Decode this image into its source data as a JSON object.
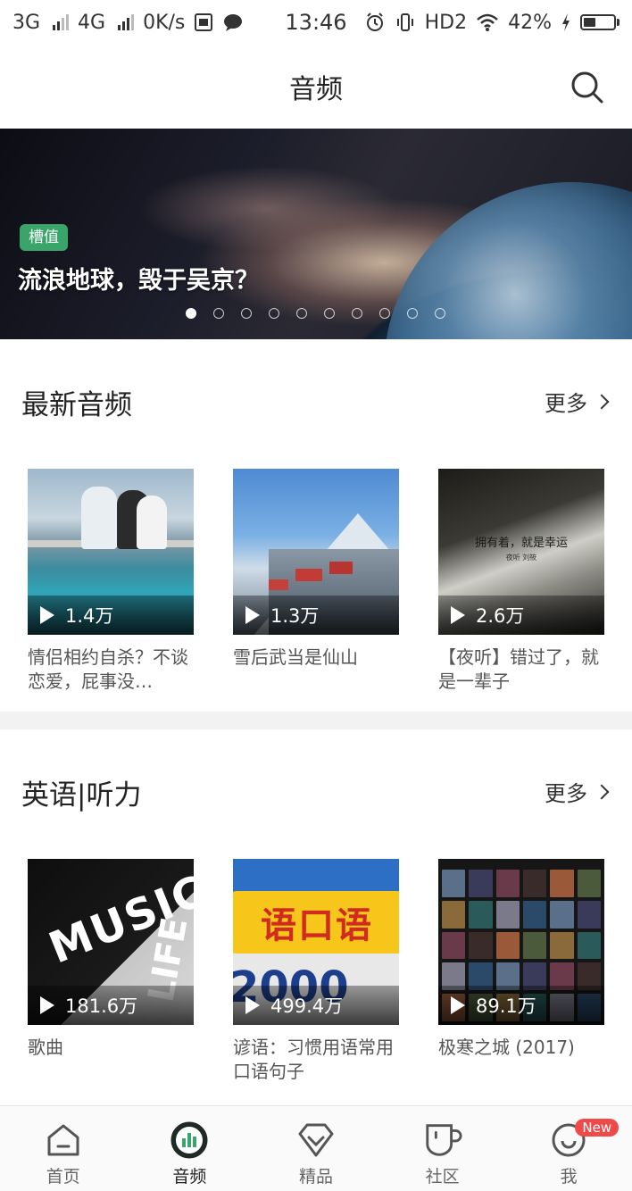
{
  "status_bar": {
    "net1": "3G",
    "net2": "4G",
    "speed": "0K/s",
    "time": "13:46",
    "hd": "HD2",
    "battery": "42%",
    "battery_level": 0.42
  },
  "header": {
    "title": "音频"
  },
  "banner": {
    "tag": "槽值",
    "title": "流浪地球，毁于吴京？",
    "dot_count": 10,
    "active_dot": 0
  },
  "sections": [
    {
      "title": "最新音频",
      "more": "更多",
      "cards": [
        {
          "plays": "1.4万",
          "title": "情侣相约自杀？不谈恋爱，屁事没…"
        },
        {
          "plays": "1.3万",
          "title": "雪后武当是仙山"
        },
        {
          "plays": "2.6万",
          "title": "【夜听】错过了，就是一辈子",
          "cover_text": "拥有着，就是幸运",
          "cover_sub": "夜听  刘筱"
        }
      ]
    },
    {
      "title": "英语|听力",
      "more": "更多",
      "cards": [
        {
          "plays": "181.6万",
          "title": "歌曲",
          "cover_text": "MUSIC",
          "cover_text2": "LIFE"
        },
        {
          "plays": "499.4万",
          "title": "谚语：习惯用语常用口语句子",
          "cover_text": "语口语",
          "cover_num": "2000"
        },
        {
          "plays": "89.1万",
          "title": "极寒之城 (2017)"
        }
      ]
    }
  ],
  "bottom_nav": [
    {
      "label": "首页",
      "icon": "home-icon",
      "active": false
    },
    {
      "label": "音频",
      "icon": "audio-icon",
      "active": true
    },
    {
      "label": "精品",
      "icon": "diamond-icon",
      "active": false
    },
    {
      "label": "社区",
      "icon": "cup-icon",
      "active": false
    },
    {
      "label": "我",
      "icon": "profile-icon",
      "active": false,
      "badge": "New"
    }
  ],
  "colors": {
    "accent_green": "#3aa56a",
    "badge_red": "#ef4a4a"
  }
}
